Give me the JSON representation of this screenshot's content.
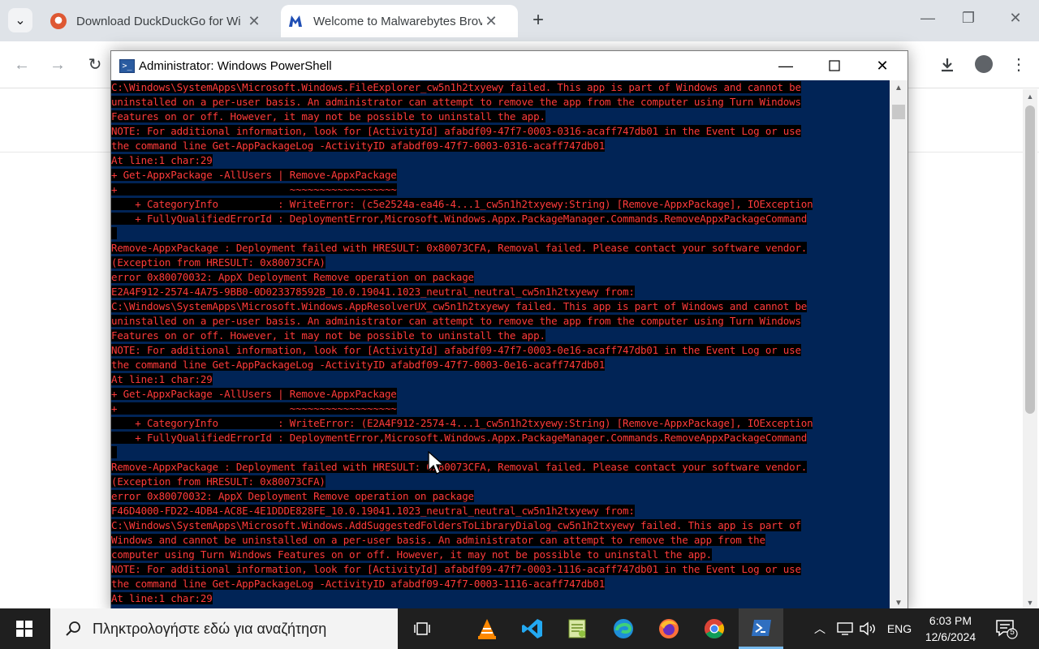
{
  "browser": {
    "tabs": [
      {
        "title": "Download DuckDuckGo for Wi",
        "icon": "duckduckgo-icon",
        "active": false
      },
      {
        "title": "Welcome to Malwarebytes Brov",
        "icon": "malwarebytes-icon",
        "active": true
      }
    ],
    "tab_dropdown_icon": "chevron-down-icon",
    "close_glyph": "✕",
    "new_tab_glyph": "+",
    "minimize_glyph": "—",
    "restore_glyph": "❐",
    "window_close_glyph": "✕"
  },
  "powershell": {
    "title": "Administrator: Windows PowerShell",
    "background_color": "#012456",
    "error_color": "#ff3b3b",
    "lines": [
      "C:\\Windows\\SystemApps\\Microsoft.Windows.FileExplorer_cw5n1h2txyewy failed. This app is part of Windows and cannot be",
      "uninstalled on a per-user basis. An administrator can attempt to remove the app from the computer using Turn Windows",
      "Features on or off. However, it may not be possible to uninstall the app.",
      "NOTE: For additional information, look for [ActivityId] afabdf09-47f7-0003-0316-acaff747db01 in the Event Log or use",
      "the command line Get-AppPackageLog -ActivityID afabdf09-47f7-0003-0316-acaff747db01",
      "At line:1 char:29",
      "+ Get-AppxPackage -AllUsers | Remove-AppxPackage",
      "+                             ~~~~~~~~~~~~~~~~~~",
      "    + CategoryInfo          : WriteError: (c5e2524a-ea46-4...1_cw5n1h2txyewy:String) [Remove-AppxPackage], IOException",
      "    + FullyQualifiedErrorId : DeploymentError,Microsoft.Windows.Appx.PackageManager.Commands.RemoveAppxPackageCommand",
      "",
      "Remove-AppxPackage : Deployment failed with HRESULT: 0x80073CFA, Removal failed. Please contact your software vendor.",
      "(Exception from HRESULT: 0x80073CFA)",
      "error 0x80070032: AppX Deployment Remove operation on package",
      "E2A4F912-2574-4A75-9BB0-0D023378592B_10.0.19041.1023_neutral_neutral_cw5n1h2txyewy from:",
      "C:\\Windows\\SystemApps\\Microsoft.Windows.AppResolverUX_cw5n1h2txyewy failed. This app is part of Windows and cannot be",
      "uninstalled on a per-user basis. An administrator can attempt to remove the app from the computer using Turn Windows",
      "Features on or off. However, it may not be possible to uninstall the app.",
      "NOTE: For additional information, look for [ActivityId] afabdf09-47f7-0003-0e16-acaff747db01 in the Event Log or use",
      "the command line Get-AppPackageLog -ActivityID afabdf09-47f7-0003-0e16-acaff747db01",
      "At line:1 char:29",
      "+ Get-AppxPackage -AllUsers | Remove-AppxPackage",
      "+                             ~~~~~~~~~~~~~~~~~~",
      "    + CategoryInfo          : WriteError: (E2A4F912-2574-4...1_cw5n1h2txyewy:String) [Remove-AppxPackage], IOException",
      "    + FullyQualifiedErrorId : DeploymentError,Microsoft.Windows.Appx.PackageManager.Commands.RemoveAppxPackageCommand",
      "",
      "Remove-AppxPackage : Deployment failed with HRESULT: 0x80073CFA, Removal failed. Please contact your software vendor.",
      "(Exception from HRESULT: 0x80073CFA)",
      "error 0x80070032: AppX Deployment Remove operation on package",
      "F46D4000-FD22-4DB4-AC8E-4E1DDDE828FE_10.0.19041.1023_neutral_neutral_cw5n1h2txyewy from:",
      "C:\\Windows\\SystemApps\\Microsoft.Windows.AddSuggestedFoldersToLibraryDialog_cw5n1h2txyewy failed. This app is part of",
      "Windows and cannot be uninstalled on a per-user basis. An administrator can attempt to remove the app from the",
      "computer using Turn Windows Features on or off. However, it may not be possible to uninstall the app.",
      "NOTE: For additional information, look for [ActivityId] afabdf09-47f7-0003-1116-acaff747db01 in the Event Log or use",
      "the command line Get-AppPackageLog -ActivityID afabdf09-47f7-0003-1116-acaff747db01",
      "At line:1 char:29"
    ]
  },
  "taskbar": {
    "search_placeholder": "Πληκτρολογήστε εδώ για αναζήτηση",
    "apps": [
      {
        "name": "task-view-icon"
      },
      {
        "name": "vlc-icon"
      },
      {
        "name": "vscode-icon"
      },
      {
        "name": "notepad-plus-plus-icon"
      },
      {
        "name": "edge-icon"
      },
      {
        "name": "firefox-icon"
      },
      {
        "name": "chrome-icon"
      },
      {
        "name": "powershell-icon",
        "active": true
      }
    ],
    "language": "ENG",
    "time": "6:03 PM",
    "date": "12/6/2024",
    "notification_count": "5"
  }
}
